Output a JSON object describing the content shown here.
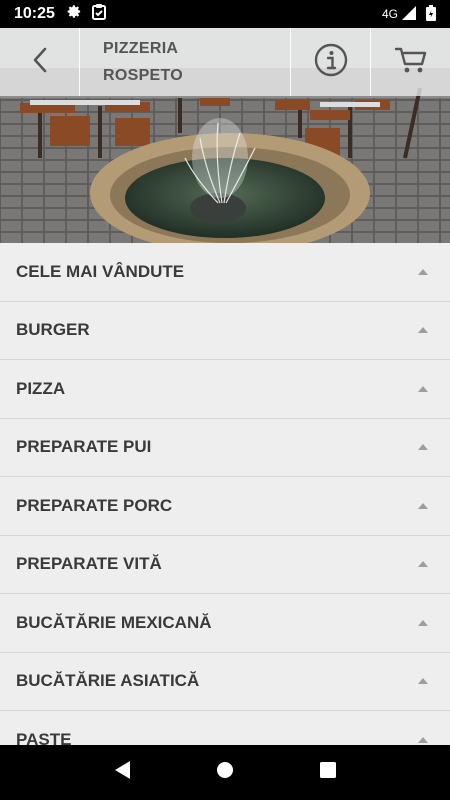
{
  "status_bar": {
    "time": "10:25",
    "network": "4G"
  },
  "header": {
    "title_line1": "PIZZERIA",
    "title_line2": "ROSPETO"
  },
  "menu": {
    "items": [
      {
        "label": "CELE MAI VÂNDUTE"
      },
      {
        "label": "BURGER"
      },
      {
        "label": "PIZZA"
      },
      {
        "label": "PREPARATE PUI"
      },
      {
        "label": "PREPARATE PORC"
      },
      {
        "label": "PREPARATE VITĂ"
      },
      {
        "label": "BUCĂTĂRIE MEXICANĂ"
      },
      {
        "label": "BUCĂTĂRIE ASIATICĂ"
      },
      {
        "label": "PASTE"
      }
    ]
  },
  "colors": {
    "header_overlay": "#ebebeb",
    "menu_bg": "#eeeeee",
    "text": "#3a3a3a",
    "caret": "#9e9e9e"
  },
  "icons": [
    "gear-icon",
    "clipboard-icon",
    "signal-icon",
    "battery-icon",
    "back-icon",
    "info-icon",
    "cart-icon",
    "nav-back-icon",
    "nav-home-icon",
    "nav-recents-icon"
  ]
}
